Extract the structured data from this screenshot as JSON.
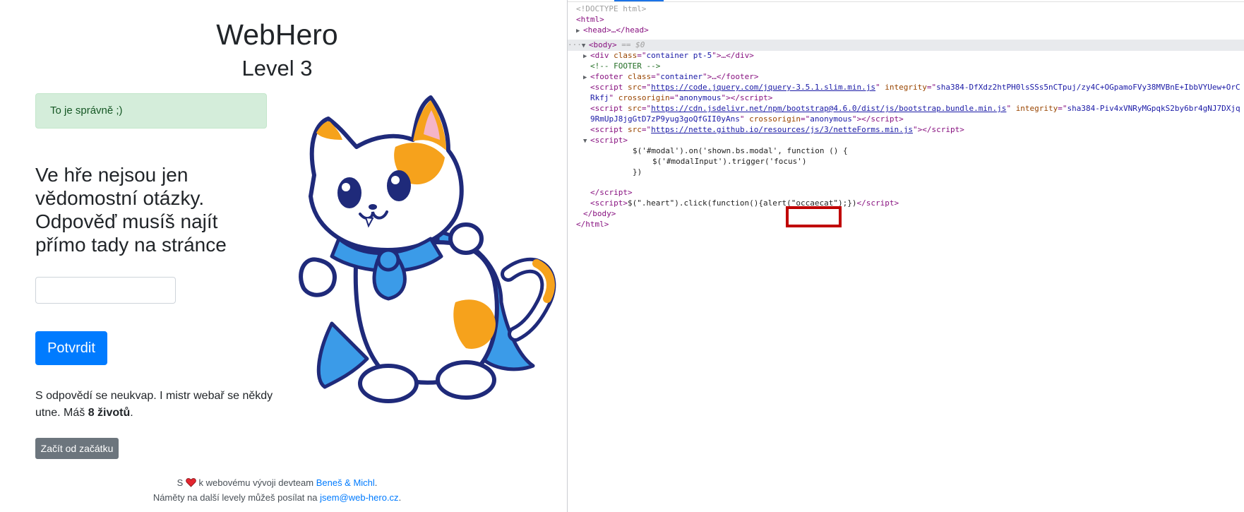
{
  "page": {
    "site_title": "WebHero",
    "level_title": "Level 3",
    "alert_text": "To je správně ;)",
    "question": "Ve hře nejsou jen vědomostní otázky. Odpověď musíš najít přímo tady na stránce",
    "answer_value": "",
    "submit_label": "Potvrdit",
    "info_prefix": "S odpovědí se neukvap. I mistr webař se někdy utne. Máš ",
    "lives": "8 životů",
    "info_suffix": ".",
    "restart_label": "Začít od začátku",
    "footer_line1_prefix": "S",
    "footer_line1_middle": "k webovému vývoji devteam",
    "footer_team_link": "Beneš & Michl",
    "footer_line1_suffix": ".",
    "footer_line2_prefix": "Náměty na další levely můžeš posílat na",
    "footer_email_link": "jsem@web-hero.cz",
    "footer_line2_suffix": ".",
    "colors": {
      "primary": "#007bff",
      "secondary": "#6c757d",
      "alert_bg": "#d4edda",
      "alert_text": "#155724",
      "heart": "#e3262f"
    },
    "icons": [
      "heart-icon",
      "cat-hero-illustration"
    ]
  },
  "devtools": {
    "doctype": "<!DOCTYPE html>",
    "html_open": "<html>",
    "head_collapsed": "<head>…</head>",
    "body_open": "<body>",
    "body_marker": " == $0",
    "div_line": {
      "tag": "div",
      "attr": "class",
      "val": "container pt-5",
      "tail": ">…</div>"
    },
    "comment": "<!-- FOOTER -->",
    "footer_line": {
      "tag": "footer",
      "attr": "class",
      "val": "container",
      "tail": ">…</footer>"
    },
    "script1_src": "https://code.jquery.com/jquery-3.5.1.slim.min.js",
    "script1_integrity": "sha384-DfXdz2htPH0lsSSs5nCTpuj/zy4C+OGpamoFVy38MVBnE+IbbVYUew+OrC",
    "script1_cont": "Rkfj",
    "script2_src": "https://cdn.jsdelivr.net/npm/bootstrap@4.6.0/dist/js/bootstrap.bundle.min.js",
    "script2_integrity": "sha384-Piv4xVNRyMGpqkS2by6br4gNJ7DXjq",
    "script2_cont": "9RmUpJ8jgGtD7zP9yug3goQfGII0yAns",
    "crossorigin": "anonymous",
    "script3_src": "https://nette.github.io/resources/js/3/netteForms.min.js",
    "script4_js_1": "$('#modal').on('shown.bs.modal', function () {",
    "script4_js_2": "$('#modalInput').trigger('focus')",
    "script4_js_3": "})",
    "script5_pre": "$(\".heart\").click(function(){alert(",
    "script5_str": "\"occaecat\"",
    "script5_post": ");})",
    "body_close": "</body>",
    "html_close": "</html>"
  }
}
